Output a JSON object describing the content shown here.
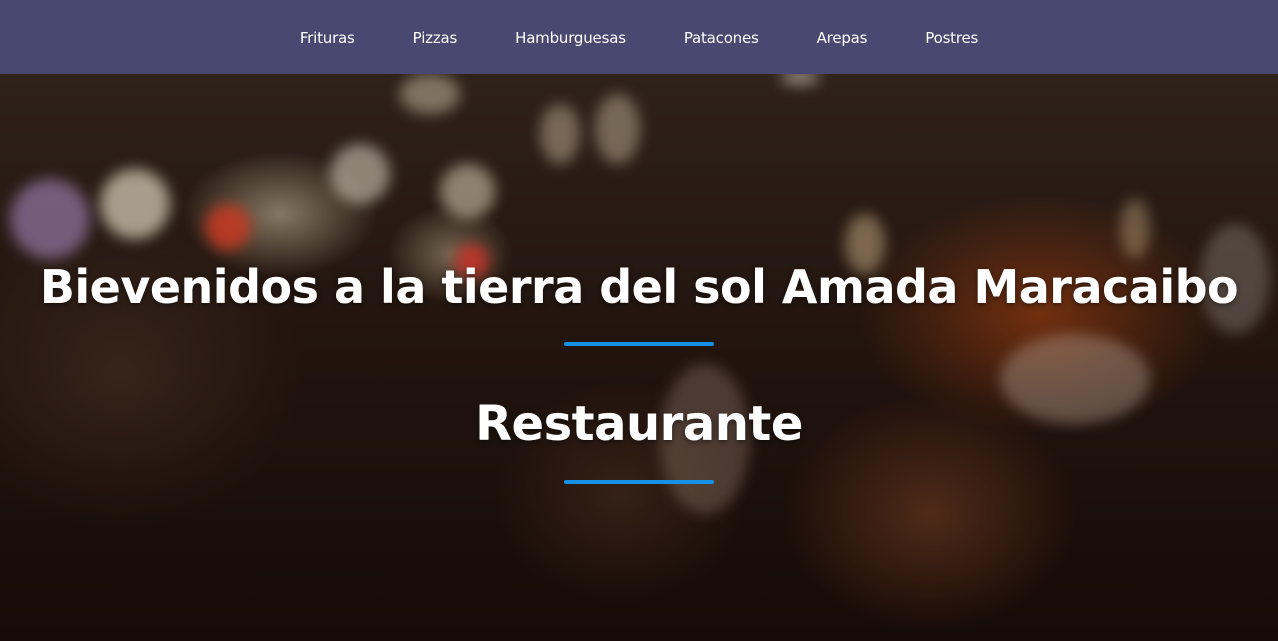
{
  "nav": {
    "items": [
      {
        "label": "Frituras"
      },
      {
        "label": "Pizzas"
      },
      {
        "label": "Hamburguesas"
      },
      {
        "label": "Patacones"
      },
      {
        "label": "Arepas"
      },
      {
        "label": "Postres"
      }
    ]
  },
  "hero": {
    "title": "Bievenidos a la tierra del sol Amada Maracaibo",
    "subtitle": "Restaurante"
  },
  "colors": {
    "navbar_bg": "#494870",
    "accent_divider": "#1592e6",
    "text": "#ffffff"
  }
}
